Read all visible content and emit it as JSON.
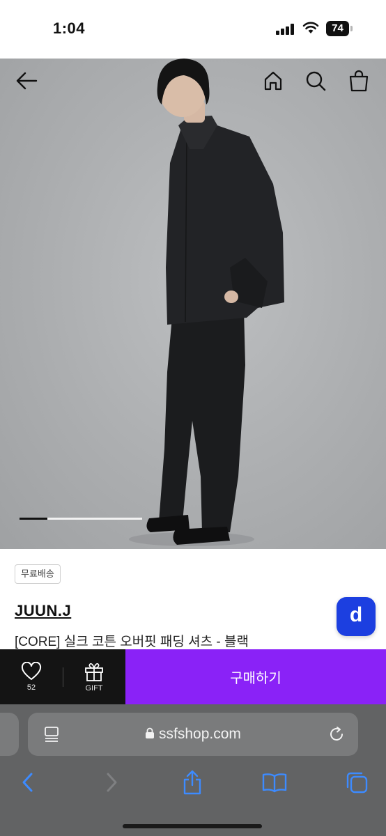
{
  "status_bar": {
    "time": "1:04",
    "battery": "74"
  },
  "hero": {
    "image_alt": "",
    "progress_fraction": 0.23
  },
  "product": {
    "badge": "무료배송",
    "brand": "JUUN.J",
    "name": "[CORE] 실크 코튼 오버핏 패딩 셔츠 - 블랙"
  },
  "buy_bar": {
    "like_count": "52",
    "gift_label": "GIFT",
    "buy_label": "구매하기"
  },
  "floating_button": {
    "label": "d"
  },
  "safari": {
    "url": "ssfshop.com"
  },
  "colors": {
    "buy": "#8a22f7",
    "dark_bar": "#141414",
    "floating": "#1c3fe0"
  }
}
